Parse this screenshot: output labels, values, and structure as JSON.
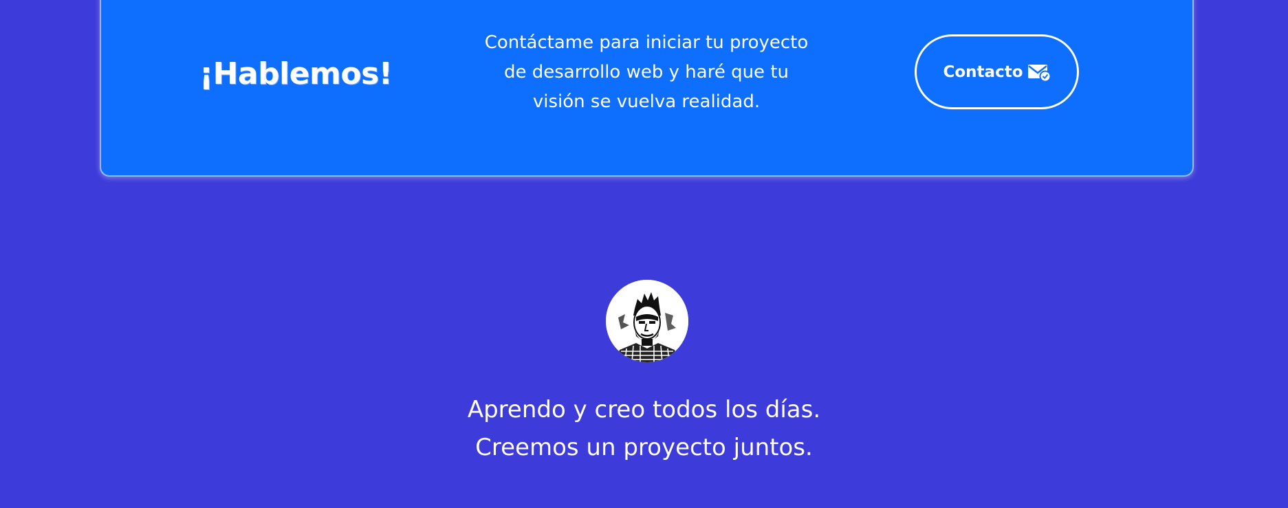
{
  "cta": {
    "title": "¡Hablemos!",
    "description": "Contáctame para iniciar tu proyecto de desarrollo web y haré que tu visión se vuelva realidad.",
    "button_label": "Contacto",
    "button_icon": "mail-check-icon"
  },
  "footer": {
    "avatar": "profile-photo",
    "line1": "Aprendo y creo todos los días.",
    "line2": "Creemos un proyecto juntos."
  },
  "colors": {
    "page_background": "#3d3bd9",
    "card_background": "#0e6ffe",
    "text": "#ffffff"
  }
}
